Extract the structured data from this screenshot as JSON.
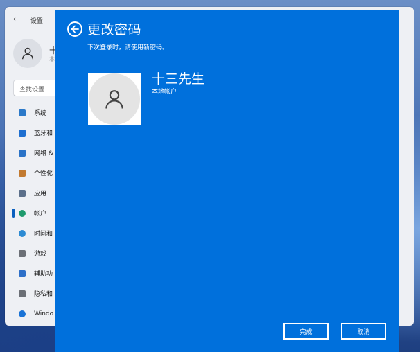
{
  "settings_window": {
    "back_glyph": "←",
    "title": "设置",
    "profile": {
      "name": "十",
      "sub": "本"
    },
    "search_placeholder": "查找设置",
    "nav_items": [
      {
        "label": "系统",
        "icon": "monitor-icon",
        "color": "#2b79c9"
      },
      {
        "label": "蓝牙和",
        "icon": "bluetooth-icon",
        "color": "#1e6fd0"
      },
      {
        "label": "网络 &",
        "icon": "wifi-icon",
        "color": "#2a73c7"
      },
      {
        "label": "个性化",
        "icon": "brush-icon",
        "color": "#c27a30"
      },
      {
        "label": "应用",
        "icon": "apps-icon",
        "color": "#5b6f8a"
      },
      {
        "label": "帐户",
        "icon": "person-icon",
        "color": "#1f9a6d",
        "active": true
      },
      {
        "label": "时间和",
        "icon": "globe-clock-icon",
        "color": "#2d8bd3"
      },
      {
        "label": "游戏",
        "icon": "gamepad-icon",
        "color": "#6b6f76"
      },
      {
        "label": "辅助功",
        "icon": "accessibility-icon",
        "color": "#2d6fc8"
      },
      {
        "label": "隐私和",
        "icon": "shield-icon",
        "color": "#6b6f76"
      },
      {
        "label": "Windo",
        "icon": "windows-update-icon",
        "color": "#1a73d6"
      }
    ]
  },
  "dialog": {
    "title": "更改密码",
    "subtitle": "下次登录时，请使用新密码。",
    "user": {
      "name": "十三先生",
      "account_type": "本地帐户"
    },
    "buttons": {
      "finish": "完成",
      "cancel": "取消"
    },
    "background_color": "#0070dc"
  }
}
